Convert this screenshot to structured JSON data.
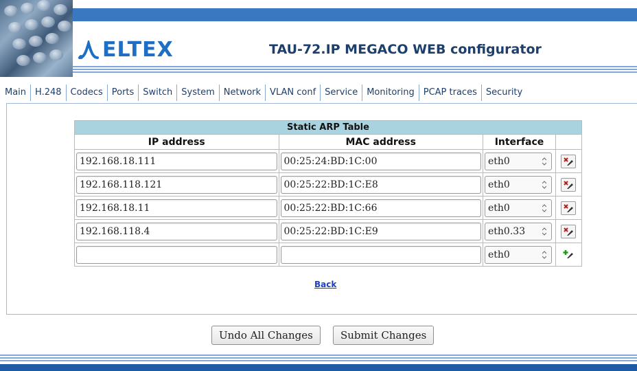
{
  "header": {
    "logo_text": "ELTEX",
    "app_title": "TAU-72.IP MEGACO WEB configurator"
  },
  "nav": {
    "items": [
      "Main",
      "H.248",
      "Codecs",
      "Ports",
      "Switch",
      "System",
      "Network",
      "VLAN conf",
      "Service",
      "Monitoring",
      "PCAP traces",
      "Security"
    ]
  },
  "arp_table": {
    "caption": "Static ARP Table",
    "columns": [
      "IP address",
      "MAC address",
      "Interface"
    ],
    "rows": [
      {
        "ip": "192.168.18.111",
        "mac": "00:25:24:BD:1C:00",
        "iface": "eth0"
      },
      {
        "ip": "192.168.118.121",
        "mac": "00:25:22:BD:1C:E8",
        "iface": "eth0"
      },
      {
        "ip": "192.168.18.11",
        "mac": "00:25:22:BD:1C:66",
        "iface": "eth0"
      },
      {
        "ip": "192.168.118.4",
        "mac": "00:25:22:BD:1C:E9",
        "iface": "eth0.33"
      },
      {
        "ip": "",
        "mac": "",
        "iface": "eth0"
      }
    ],
    "delete_icon": "delete-row-icon",
    "add_icon": "add-row-icon"
  },
  "links": {
    "back": "Back"
  },
  "buttons": {
    "undo": "Undo All Changes",
    "submit": "Submit Changes"
  },
  "colors": {
    "header_blue": "#3a78c2",
    "logo_blue": "#1e6fc4",
    "table_caption_bg": "#a9d3df",
    "footer_blue": "#1f5aa6"
  }
}
